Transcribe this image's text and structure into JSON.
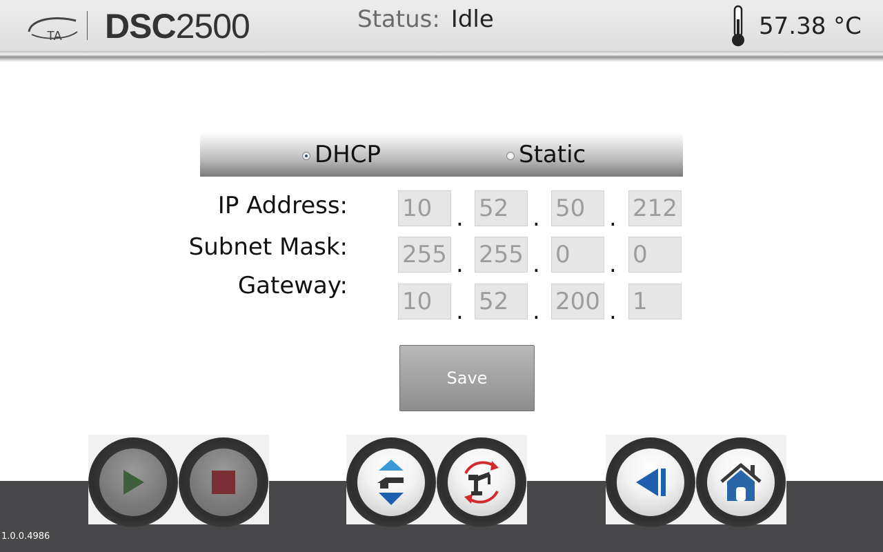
{
  "header": {
    "brand_logo_text": "TA",
    "product_bold": "DSC",
    "product_light": "2500",
    "status_label": "Status:",
    "status_value": "Idle",
    "temperature": "57.38 °C"
  },
  "network": {
    "modes": [
      {
        "label": "DHCP",
        "selected": true
      },
      {
        "label": "Static",
        "selected": false
      }
    ],
    "rows": [
      {
        "label": "IP Address:",
        "octets": [
          "10",
          "52",
          "50",
          "212"
        ]
      },
      {
        "label": "Subnet Mask:",
        "octets": [
          "255",
          "255",
          "0",
          "0"
        ]
      },
      {
        "label": "Gateway:",
        "octets": [
          "10",
          "52",
          "200",
          "1"
        ]
      }
    ],
    "separator": ".",
    "save_label": "Save"
  },
  "controls": [
    {
      "icon": "play-icon",
      "enabled": false,
      "color": "#3d5f3a"
    },
    {
      "icon": "stop-icon",
      "enabled": false,
      "color": "#7b2f35"
    },
    {
      "icon": "lid-open-close-icon",
      "enabled": true,
      "color": "#1f6fb6"
    },
    {
      "icon": "autosampler-robot-icon",
      "enabled": true,
      "color": "#d22b2b"
    },
    {
      "icon": "back-icon",
      "enabled": true,
      "color": "#1f5faf"
    },
    {
      "icon": "home-icon",
      "enabled": true,
      "color": "#2a66a8"
    }
  ],
  "footer": {
    "version": "1.0.0.4986"
  }
}
